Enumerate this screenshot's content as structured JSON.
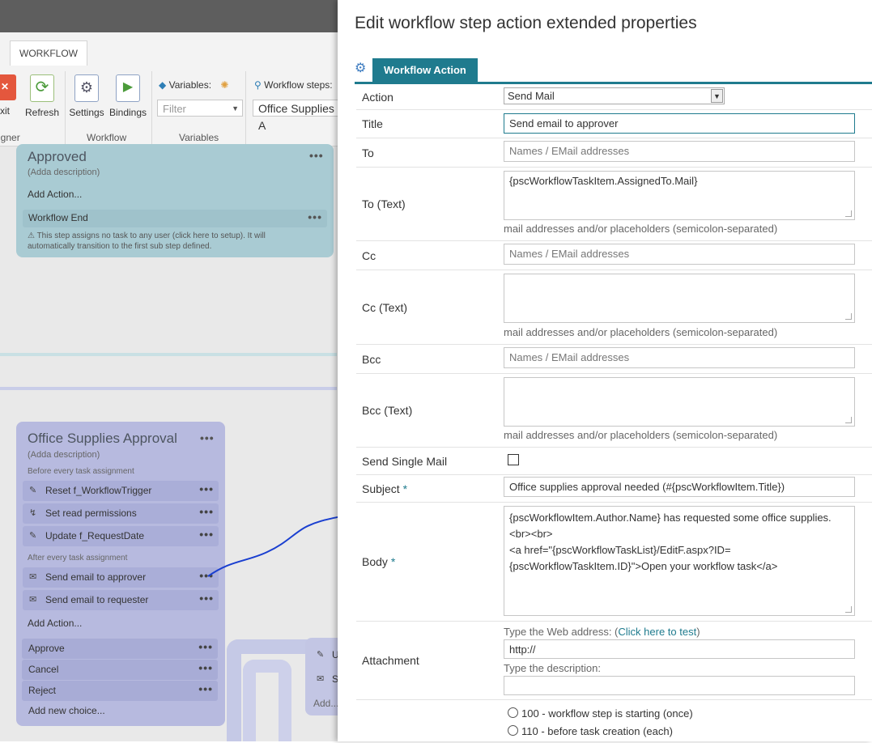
{
  "background": {
    "ribbon": {
      "tab": "WORKFLOW",
      "exit_label": "xit",
      "refresh_label": "Refresh",
      "settings_label": "Settings",
      "bindings_label": "Bindings",
      "variables_label": "Variables:",
      "filter_placeholder": "Filter",
      "workflow_steps_label": "Workflow steps:",
      "workflow_steps_value": "Office Supplies A",
      "groups": {
        "designer": "igner",
        "workflow": "Workflow",
        "variables": "Variables"
      }
    },
    "approved_card": {
      "title": "Approved",
      "description": "(Adda description)",
      "add_action": "Add Action...",
      "workflow_end": "Workflow End",
      "note": "⚠ This step assigns no task to any user (click here to setup). It will automatically transition to the first sub step defined."
    },
    "office_card": {
      "title": "Office Supplies Approval",
      "description": "(Adda description)",
      "before_label": "Before every task assignment",
      "before_actions": [
        "Reset f_WorkflowTrigger",
        "Set read permissions",
        "Update f_RequestDate"
      ],
      "after_label": "After every task assignment",
      "after_actions": [
        "Send email to approver",
        "Send email to requester"
      ],
      "add_action": "Add Action...",
      "choices": [
        "Approve",
        "Cancel",
        "Reject"
      ],
      "add_choice": "Add new choice..."
    },
    "side_card": {
      "item1": "U",
      "item2": "S",
      "add": "Add..."
    },
    "colors": {
      "approved_card": "#a9cbd3",
      "office_card": "#b7badf",
      "accent_line": "#bfcbe6"
    }
  },
  "dialog": {
    "title": "Edit workflow step action extended properties",
    "tab": "Workflow Action",
    "accent_color": "#1f7b8e",
    "fields": {
      "action": {
        "label": "Action",
        "value": "Send Mail"
      },
      "title": {
        "label": "Title",
        "value": "Send email to approver"
      },
      "to": {
        "label": "To",
        "placeholder": "Names / EMail addresses"
      },
      "to_text": {
        "label": "To (Text)",
        "value": "{pscWorkflowTaskItem.AssignedTo.Mail}",
        "hint": "mail addresses and/or placeholders (semicolon-separated)"
      },
      "cc": {
        "label": "Cc",
        "placeholder": "Names / EMail addresses"
      },
      "cc_text": {
        "label": "Cc (Text)",
        "value": "",
        "hint": "mail addresses and/or placeholders (semicolon-separated)"
      },
      "bcc": {
        "label": "Bcc",
        "placeholder": "Names / EMail addresses"
      },
      "bcc_text": {
        "label": "Bcc (Text)",
        "value": "",
        "hint": "mail addresses and/or placeholders (semicolon-separated)"
      },
      "send_single_mail": {
        "label": "Send Single Mail",
        "checked": false
      },
      "subject": {
        "label": "Subject",
        "required_mark": "*",
        "value": "Office supplies approval needed (#{pscWorkflowItem.Title})"
      },
      "body": {
        "label": "Body",
        "required_mark": "*",
        "value": "{pscWorkflowItem.Author.Name} has requested some office supplies.\n<br><br>\n<a href=\"{pscWorkflowTaskList}/EditF.aspx?ID=\n{pscWorkflowTaskItem.ID}\">Open your workflow task</a>"
      },
      "attachment": {
        "label": "Attachment",
        "web_address_label": "Type the Web address: (",
        "test_link": "Click here to test",
        "web_address_suffix": ")",
        "url_value": "http://",
        "description_label": "Type the description:",
        "description_value": ""
      },
      "timing_options": [
        "100 - workflow step is starting (once)",
        "110 - before task creation (each)"
      ]
    }
  }
}
